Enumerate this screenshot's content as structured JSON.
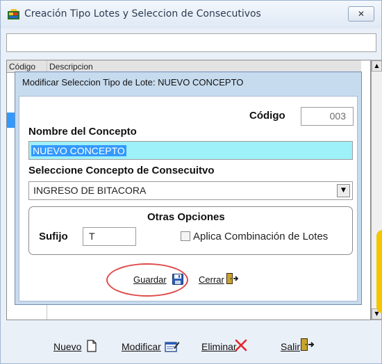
{
  "window": {
    "title": "Creación Tipo Lotes y Seleccion de Consecutivos",
    "close_glyph": "✕",
    "app_icon": "lots-app-icon"
  },
  "grid": {
    "columns": [
      "Código",
      "Descripcion"
    ],
    "scroll_up_glyph": "▲",
    "scroll_down_glyph": "▼"
  },
  "dialog": {
    "title": "Modificar Seleccion Tipo de Lote: NUEVO CONCEPTO",
    "codigo": {
      "label": "Código",
      "value": "003"
    },
    "nombre": {
      "label": "Nombre del Concepto",
      "value": "NUEVO CONCEPTO"
    },
    "concepto": {
      "label": "Seleccione Concepto de Consecuitvo",
      "selected": "INGRESO DE BITACORA",
      "arrow_glyph": "▼"
    },
    "otras": {
      "title": "Otras Opciones",
      "sufijo_label": "Sufijo",
      "sufijo_value": "T",
      "aplica_label": "Aplica Combinación de Lotes",
      "aplica_checked": false
    },
    "buttons": {
      "guardar": "Guardar",
      "cerrar": "Cerrar"
    }
  },
  "toolbar": {
    "nuevo": "Nuevo",
    "modificar": "Modificar",
    "eliminar": "Eliminar",
    "salir": "Salir"
  },
  "colors": {
    "selection": "#3399ff",
    "name_field_bg": "#9ef0f9",
    "highlight_ring": "#e04848",
    "delete_red": "#e0262b"
  }
}
